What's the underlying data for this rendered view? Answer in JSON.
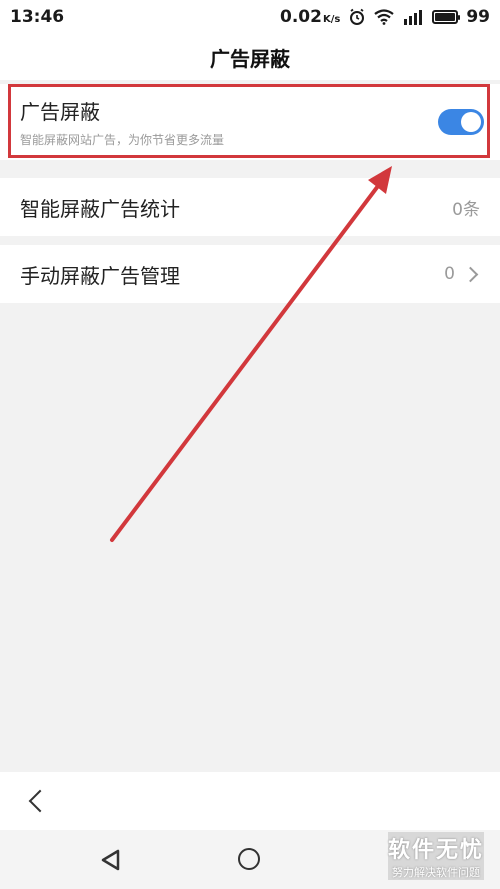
{
  "status_bar": {
    "time": "13:46",
    "net_speed": "0.02",
    "net_unit": "K/s",
    "battery": "99",
    "battery_level": 0.99
  },
  "header": {
    "title": "广告屏蔽"
  },
  "ad_block": {
    "title": "广告屏蔽",
    "subtitle": "智能屏蔽网站广告，为你节省更多流量",
    "enabled": true
  },
  "items": [
    {
      "label": "智能屏蔽广告统计",
      "value": "0条"
    },
    {
      "label": "手动屏蔽广告管理",
      "value": "0"
    }
  ],
  "watermark": {
    "main": "软件无忧",
    "sub": "努力解决软件问题"
  },
  "colors": {
    "accent": "#3b86e4",
    "highlight": "#d2383c",
    "arrow": "#d2383c"
  },
  "icons": [
    "alarm-icon",
    "wifi-icon",
    "signal-icon",
    "battery-icon",
    "chevron-right-icon",
    "back-icon",
    "nav-back-icon",
    "nav-home-icon"
  ]
}
